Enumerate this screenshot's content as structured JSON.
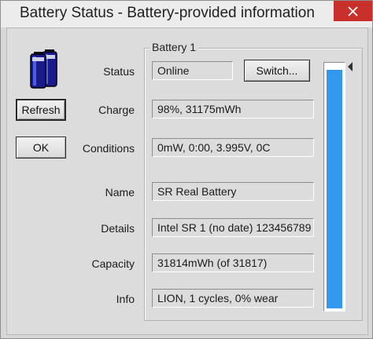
{
  "window": {
    "title": "Battery Status - Battery-provided information"
  },
  "buttons": {
    "refresh": "Refresh",
    "ok": "OK",
    "switch": "Switch..."
  },
  "group": {
    "title": "Battery 1"
  },
  "fields": {
    "status": {
      "label": "Status",
      "value": "Online"
    },
    "charge": {
      "label": "Charge",
      "value": "98%, 31175mWh"
    },
    "conditions": {
      "label": "Conditions",
      "value": "0mW, 0:00, 3.995V, 0C"
    },
    "name": {
      "label": "Name",
      "value": "SR Real Battery"
    },
    "details": {
      "label": "Details",
      "value": "Intel SR 1 (no date) 123456789"
    },
    "capacity": {
      "label": "Capacity",
      "value": "31814mWh (of 31817)"
    },
    "info": {
      "label": "Info",
      "value": "LION, 1 cycles, 0% wear"
    }
  },
  "level": {
    "percent": 98,
    "color": "#3399ee"
  },
  "icons": {
    "close": "close-icon",
    "battery": "battery-icon"
  },
  "colors": {
    "close_button": "#c9302c",
    "window_bg": "#d7d7d7"
  }
}
